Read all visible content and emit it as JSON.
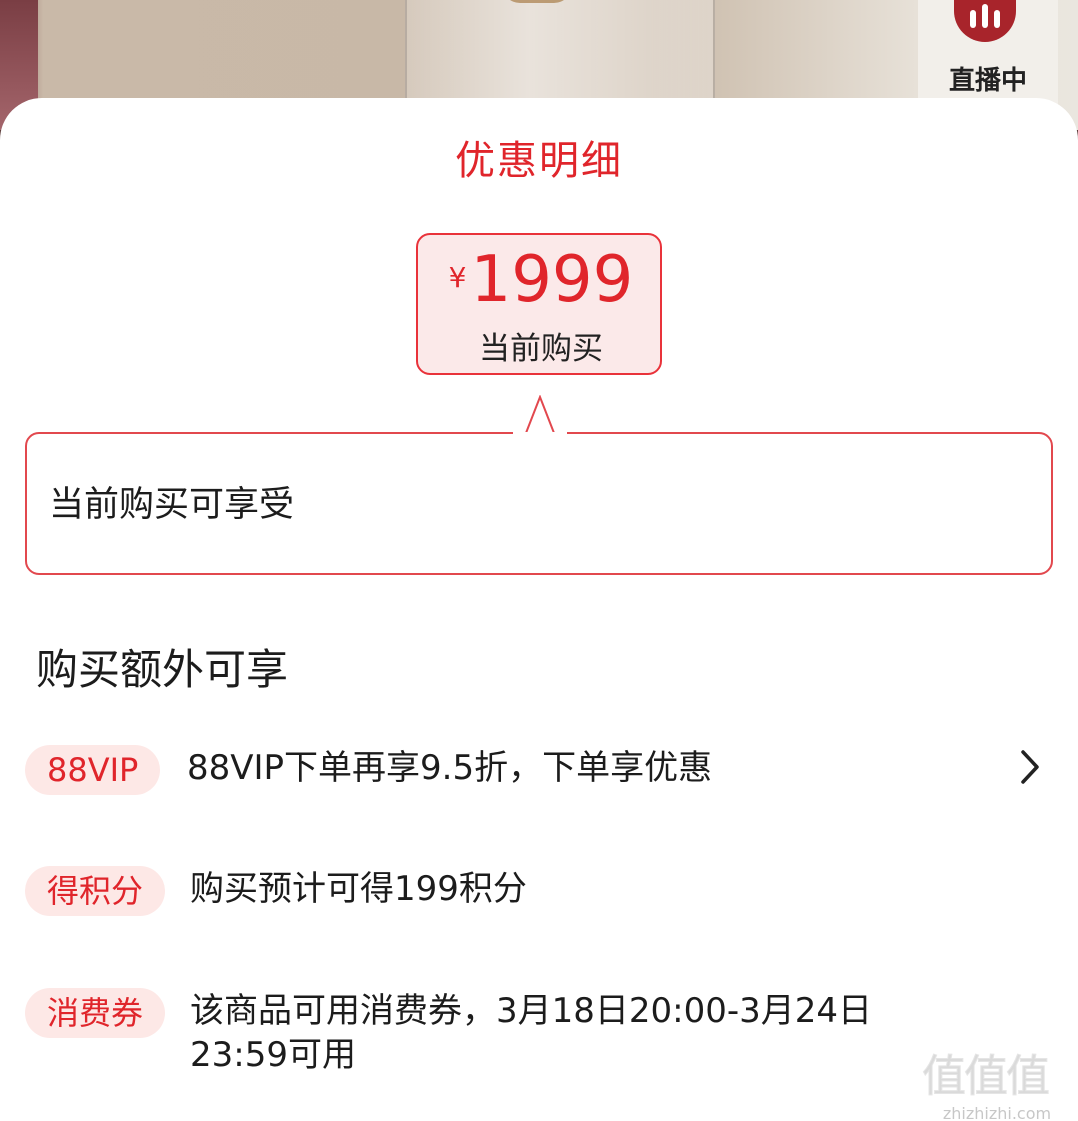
{
  "background": {
    "live_label": "直播中"
  },
  "sheet": {
    "title": "优惠明细",
    "price": {
      "currency": "¥",
      "amount": "1999",
      "label": "当前购买"
    },
    "benefit_text": "当前购买可享受",
    "extra_title": "购买额外可享",
    "rows": [
      {
        "tag": "88VIP",
        "text": "88VIP下单再享9.5折，下单享优惠",
        "has_chevron": true
      },
      {
        "tag": "得积分",
        "text": "购买预计可得199积分",
        "has_chevron": false
      },
      {
        "tag": "消费券",
        "text_line1": "该商品可用消费券，3月18日20:00-3月24日",
        "text_line2": "23:59可用",
        "has_chevron": false
      }
    ]
  },
  "watermark": {
    "glyphs": "值值值",
    "url": "zhizhizhi.com"
  },
  "colors": {
    "accent": "#e0252b",
    "tag_bg": "#fde8e6",
    "price_bg": "#fbe9e9"
  }
}
